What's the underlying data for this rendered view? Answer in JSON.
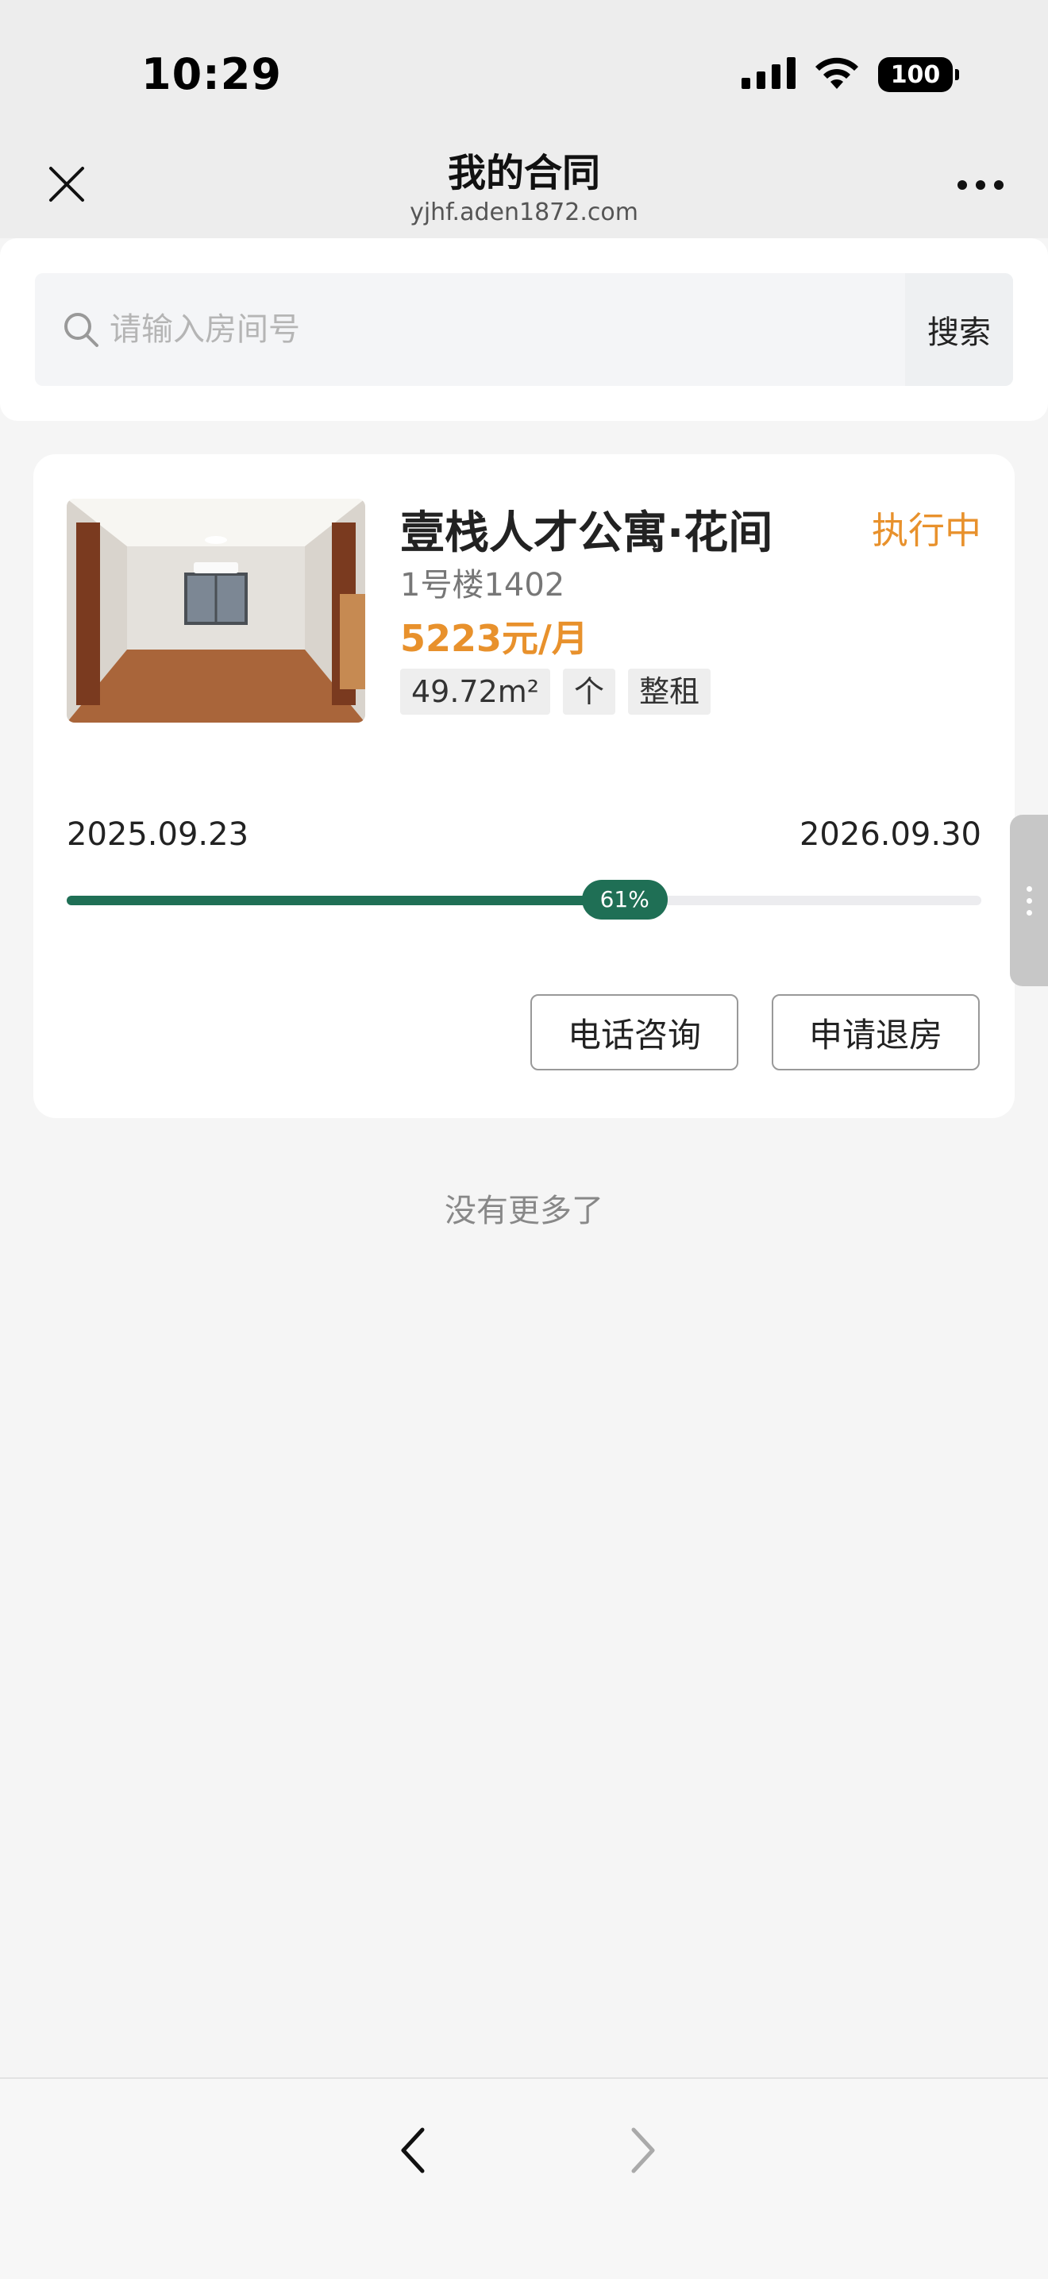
{
  "status_bar": {
    "time": "10:29",
    "battery": "100",
    "icons": [
      "signal-icon",
      "wifi-icon",
      "battery-icon"
    ]
  },
  "nav": {
    "title": "我的合同",
    "subtitle": "yjhf.aden1872.com",
    "close_icon": "close-icon",
    "more_icon": "more-icon"
  },
  "search": {
    "placeholder": "请输入房间号",
    "value": "",
    "button_label": "搜索",
    "icon": "search-icon"
  },
  "contract": {
    "title": "壹栈人才公寓·花间",
    "status": "执行中",
    "room": "1号楼1402",
    "price": "5223元/月",
    "tags": [
      "49.72m²",
      "个",
      "整租"
    ],
    "start_date": "2025.09.23",
    "end_date": "2026.09.30",
    "progress": 61,
    "progress_label": "61%",
    "buttons": {
      "call": "电话咨询",
      "checkout": "申请退房"
    }
  },
  "footer_note": "没有更多了",
  "colors": {
    "accent_orange": "#e8912c",
    "progress_green": "#1f6f55",
    "background": "#f5f5f5"
  },
  "bottom_nav": {
    "back_icon": "chevron-left-icon",
    "forward_icon": "chevron-right-icon"
  }
}
